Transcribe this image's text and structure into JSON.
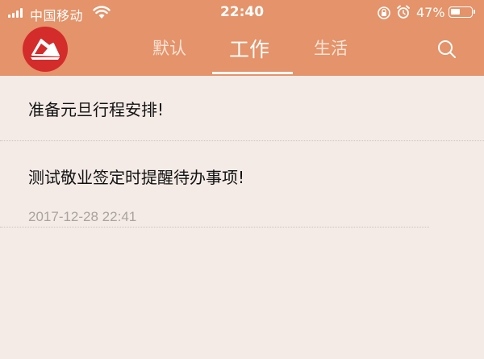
{
  "status_bar": {
    "carrier": "中国移动",
    "time": "22:40",
    "battery_percent": "47%",
    "battery_level": 0.47
  },
  "nav": {
    "tabs": [
      {
        "label": "默认",
        "active": false
      },
      {
        "label": "工作",
        "active": true
      },
      {
        "label": "生活",
        "active": false
      }
    ]
  },
  "items": [
    {
      "title": "准备元旦行程安排!",
      "reminder": ""
    },
    {
      "title": "测试敬业签定时提醒待办事项!",
      "reminder": "2017-12-28 22:41"
    }
  ],
  "colors": {
    "header": "#e4936a",
    "background": "#f4ebe6",
    "logo": "#d42b2b"
  }
}
